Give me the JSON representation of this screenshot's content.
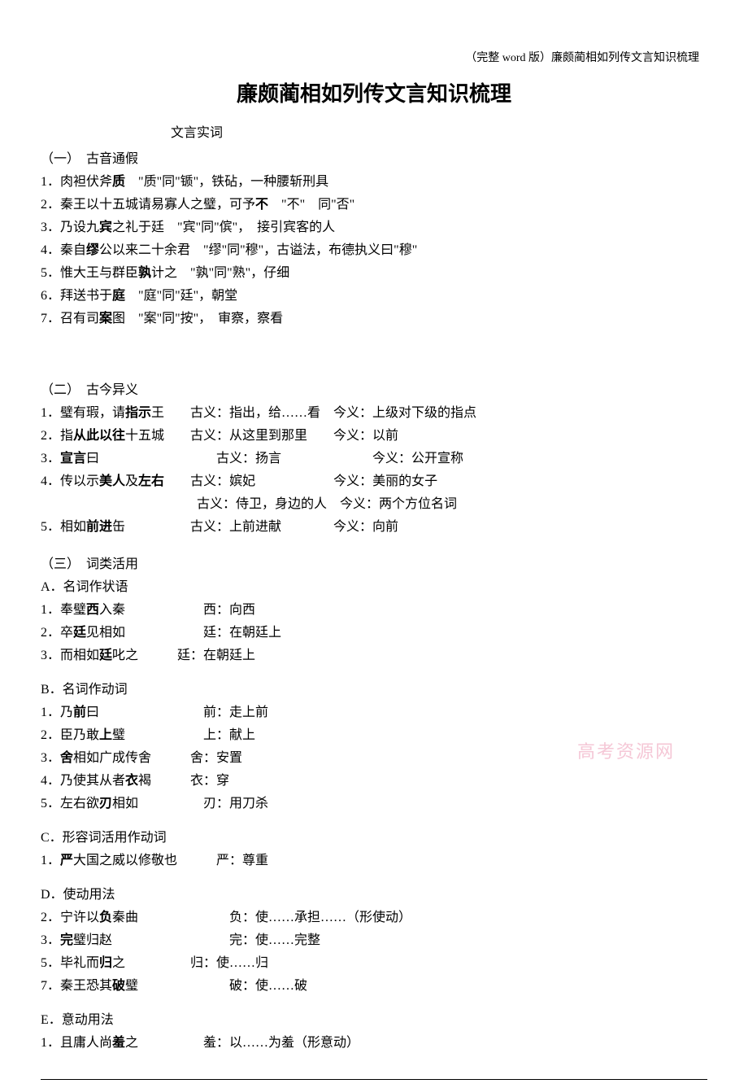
{
  "meta": "（完整 word 版）廉颇蔺相如列传文言知识梳理",
  "title": "廉颇蔺相如列传文言知识梳理",
  "section_label": "文言实词",
  "h1": "（一）　古音通假",
  "s1": {
    "i1": "1．肉袒伏斧质　\"质\"同\"锧\"，铁砧，一种腰斩刑具",
    "i2": "2．秦王以十五城请易寡人之璧，可予不　\"不\"　同\"否\"",
    "i3": "3．乃设九宾之礼于廷　\"宾\"同\"傧\"，　接引宾客的人",
    "i4": "4．秦自缪公以来二十余君　\"缪\"同\"穆\"，古谥法，布德执义曰\"穆\"",
    "i5": "5．惟大王与群臣孰计之　\"孰\"同\"熟\"，仔细",
    "i6": "6．拜送书于庭　\"庭\"同\"廷\"，朝堂",
    "i7": "7．召有司案图　\"案\"同\"按\"，　审察，察看"
  },
  "h2": "（二）　古今异义",
  "s2": {
    "i1": "1．璧有瑕，请指示王　　古义：指出，给……看　今义：上级对下级的指点",
    "i2": "2．指从此以往十五城　　古义：从这里到那里　　今义：以前",
    "i3": "3．宣言曰　　　　　　　　　古义：扬言　　　　　　　今义：公开宣称",
    "i4": "4．传以示美人及左右　　古义：嫔妃　　　　　　今义：美丽的女子",
    "i4b": "　　　　　　　　　　　　古义：侍卫，身边的人　今义：两个方位名词",
    "i5": "5．相如前进缶　　　　　古义：上前进献　　　　今义：向前"
  },
  "h3": "（三）　词类活用",
  "h3a": "A．名词作状语",
  "s3a": {
    "i1": "1．奉璧西入秦　　　　　　西：向西",
    "i2": "2．卒廷见相如　　　　　　廷：在朝廷上",
    "i3": "3．而相如廷叱之　　　廷：在朝廷上"
  },
  "h3b": "B．名词作动词",
  "s3b": {
    "i1": "1．乃前曰　　　　　　　　前：走上前",
    "i2": "2．臣乃敢上璧　　　　　　上：献上",
    "i3": "3．舍相如广成传舍　　　舍：安置",
    "i4": "4．乃使其从者衣褐　　　衣：穿",
    "i5": "5．左右欲刃相如　　　　　刃：用刀杀"
  },
  "h3c": "C．形容词活用作动词",
  "s3c": {
    "i1": "1．严大国之威以修敬也　　　严：尊重"
  },
  "h3d": "D．使动用法",
  "s3d": {
    "i2": "2．宁许以负秦曲　　　　　　　负：使……承担……（形使动）",
    "i3": "3．完璧归赵　　　　　　　　　完：使……完整",
    "i5": "5．毕礼而归之　　　　　归：使……归",
    "i7": "7．秦王恐其破璧　　　　　　　破：使……破"
  },
  "h3e": "E．意动用法",
  "s3e": {
    "i1": "1．且庸人尚羞之　　　　　羞：以……为羞（形意动）"
  },
  "watermark": "高考资源网"
}
